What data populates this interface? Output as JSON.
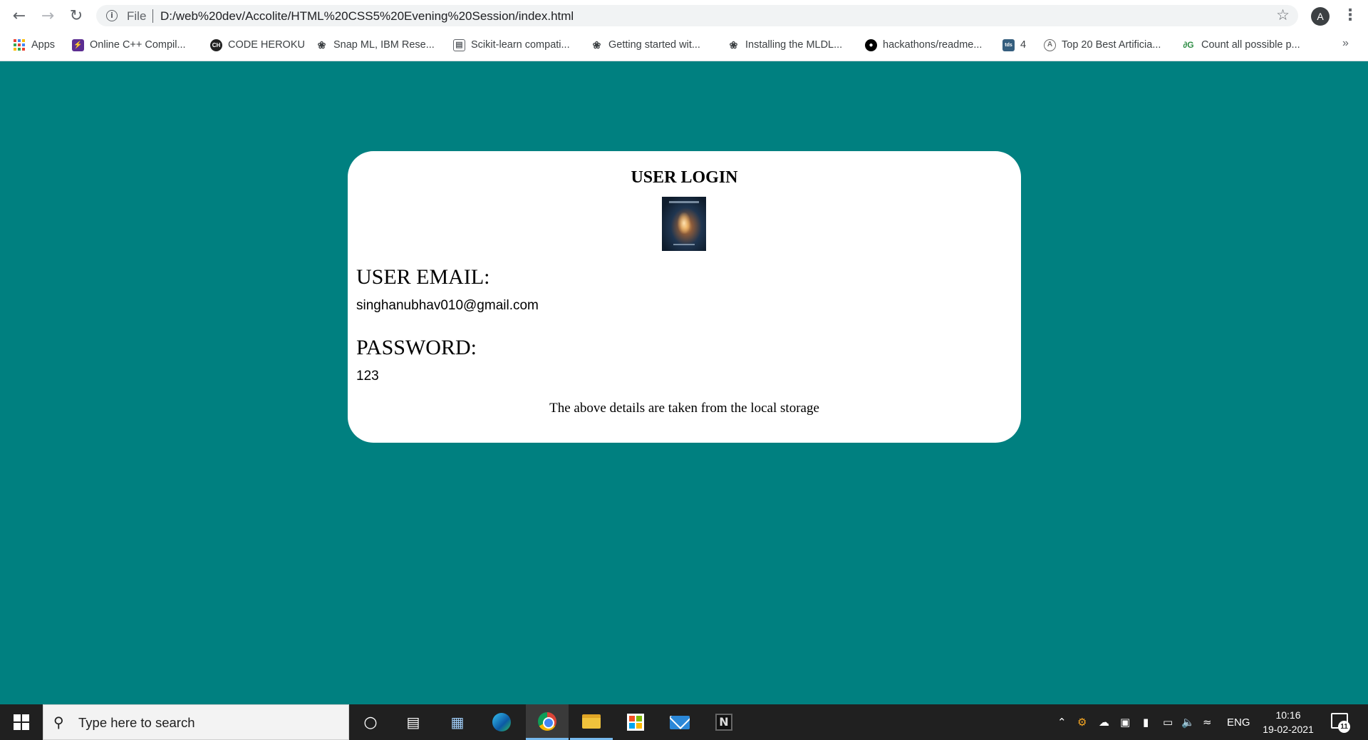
{
  "browser": {
    "file_label": "File",
    "url": "D:/web%20dev/Accolite/HTML%20CSS5%20Evening%20Session/index.html",
    "avatar_initial": "A",
    "bookmarks": [
      {
        "label": "Apps",
        "icon": "apps-grid-icon"
      },
      {
        "label": "Online C++ Compil...",
        "icon": "lightning-icon",
        "color": "#5c2d91"
      },
      {
        "label": "CODE HEROKU",
        "icon": "code-heroku-icon",
        "color": "#222222"
      },
      {
        "label": "Snap ML, IBM Rese...",
        "icon": "ibm-bee-icon",
        "color": "#3c4043"
      },
      {
        "label": "Scikit-learn compati...",
        "icon": "book-icon",
        "color": "#5f6368"
      },
      {
        "label": "Getting started wit...",
        "icon": "ibm-bee-icon",
        "color": "#3c4043"
      },
      {
        "label": "Installing the MLDL...",
        "icon": "ibm-bee-icon",
        "color": "#3c4043"
      },
      {
        "label": "hackathons/readme...",
        "icon": "github-icon",
        "color": "#000000"
      },
      {
        "label": "4",
        "icon": "tds-icon",
        "color": "#355e7e"
      },
      {
        "label": "Top 20 Best Artificia...",
        "icon": "analytics-icon",
        "color": "#6b6b6b"
      },
      {
        "label": "Count all possible p...",
        "icon": "geeksforgeeks-icon",
        "color": "#2f8d46"
      }
    ],
    "more_label": "»"
  },
  "card": {
    "title": "USER LOGIN",
    "email_label": "USER EMAIL:",
    "email_value": "singhanubhav010@gmail.com",
    "password_label": "PASSWORD:",
    "password_value": "123",
    "note": "The above details are taken from the local storage"
  },
  "taskbar": {
    "search_placeholder": "Type here to search",
    "language": "ENG",
    "time": "10:16",
    "date": "19-02-2021",
    "notification_count": "11"
  },
  "colors": {
    "page_background": "#008080",
    "card_background": "#ffffff",
    "taskbar_background": "#202020"
  }
}
